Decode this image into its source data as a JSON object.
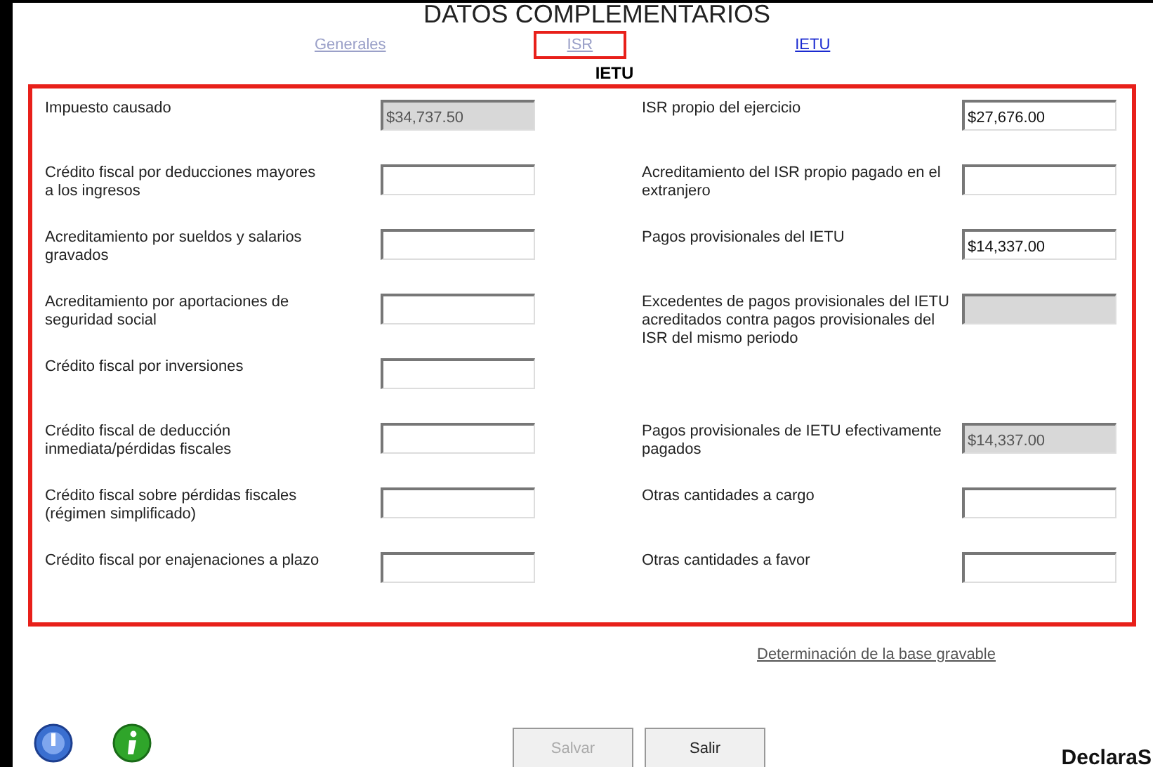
{
  "title": "DATOS COMPLEMENTARIOS",
  "tabs": [
    {
      "label": "Generales",
      "disabled": true,
      "highlighted": false
    },
    {
      "label": "ISR",
      "disabled": true,
      "highlighted": true
    },
    {
      "label": "IETU",
      "disabled": false,
      "highlighted": false
    }
  ],
  "section_title": "IETU",
  "left_fields": [
    {
      "label": "Impuesto causado",
      "value": "$34,737.50",
      "disabled": true
    },
    {
      "label": "Crédito fiscal por deducciones mayores a los ingresos",
      "disabled": false
    },
    {
      "label": "Acreditamiento por sueldos y salarios gravados",
      "disabled": false
    },
    {
      "label": "Acreditamiento por aportaciones de seguridad social",
      "disabled": false
    },
    {
      "label": "Crédito fiscal por inversiones",
      "disabled": false
    },
    {
      "label": "Crédito fiscal de deducción inmediata/pérdidas fiscales",
      "disabled": false
    },
    {
      "label": "Crédito fiscal sobre pérdidas fiscales (régimen simplificado)",
      "disabled": false
    },
    {
      "label": "Crédito fiscal por enajenaciones a plazo",
      "disabled": false
    }
  ],
  "right_fields": [
    {
      "label": "ISR propio del ejercicio",
      "value": "$27,676.00",
      "disabled": false
    },
    {
      "label": "Acreditamiento del ISR propio pagado en el extranjero",
      "disabled": false
    },
    {
      "label": "Pagos provisionales del IETU",
      "value": "$14,337.00",
      "disabled": false
    },
    {
      "label": "Excedentes de pagos provisionales del IETU acreditados contra pagos provisionales del ISR del mismo periodo",
      "disabled": true
    },
    {
      "label": "Pagos provisionales de IETU efectivamente pagados",
      "value": "$14,337.00",
      "disabled": true
    },
    {
      "label": "Otras cantidades a cargo",
      "disabled": false
    },
    {
      "label": "Otras cantidades a favor",
      "disabled": false
    }
  ],
  "base_link": "Determinación de la base gravable",
  "buttons": [
    {
      "label": "Salvar",
      "disabled": true
    },
    {
      "label": "Salir",
      "disabled": false
    }
  ],
  "logo": "DeclaraS"
}
